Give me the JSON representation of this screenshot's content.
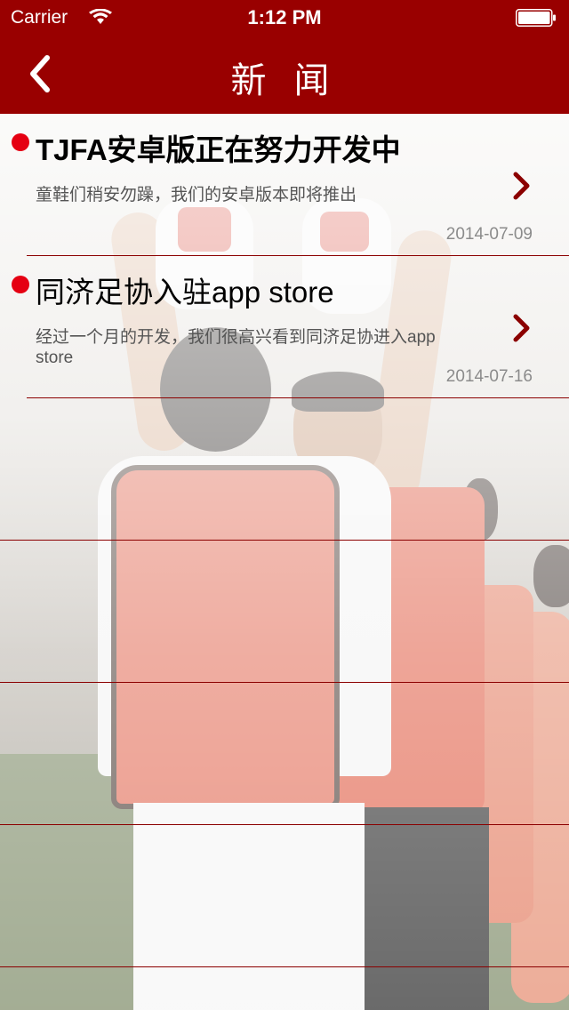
{
  "status_bar": {
    "carrier": "Carrier",
    "time": "1:12 PM"
  },
  "nav": {
    "title": "新 闻"
  },
  "news": [
    {
      "headline": "TJFA安卓版正在努力开发中",
      "summary": "童鞋们稍安勿躁，我们的安卓版本即将推出",
      "date": "2014-07-09"
    },
    {
      "headline": "同济足协入驻app store",
      "summary": "经过一个月的开发，我们很高兴看到同济足协进入app store",
      "date": "2014-07-16"
    }
  ],
  "colors": {
    "nav_bar": "#990000",
    "bullet": "#e50012",
    "separator": "#8b0000",
    "chevron": "#8b0000"
  },
  "icons": {
    "back": "chevron-left-icon",
    "disclosure": "chevron-right-icon",
    "wifi": "wifi-icon",
    "battery": "battery-icon"
  }
}
